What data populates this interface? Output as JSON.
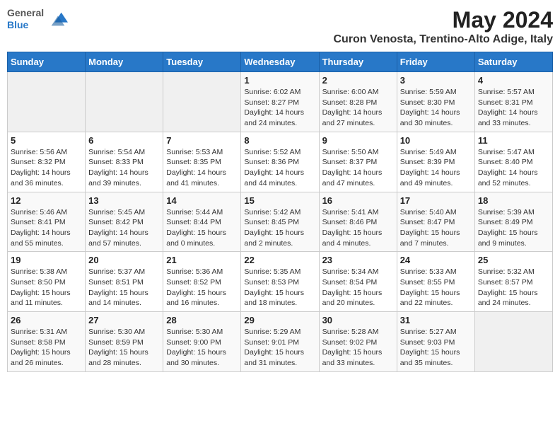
{
  "header": {
    "logo_line1": "General",
    "logo_line2": "Blue",
    "title": "May 2024",
    "subtitle": "Curon Venosta, Trentino-Alto Adige, Italy"
  },
  "weekdays": [
    "Sunday",
    "Monday",
    "Tuesday",
    "Wednesday",
    "Thursday",
    "Friday",
    "Saturday"
  ],
  "weeks": [
    [
      {
        "day": "",
        "info": ""
      },
      {
        "day": "",
        "info": ""
      },
      {
        "day": "",
        "info": ""
      },
      {
        "day": "1",
        "info": "Sunrise: 6:02 AM\nSunset: 8:27 PM\nDaylight: 14 hours and 24 minutes."
      },
      {
        "day": "2",
        "info": "Sunrise: 6:00 AM\nSunset: 8:28 PM\nDaylight: 14 hours and 27 minutes."
      },
      {
        "day": "3",
        "info": "Sunrise: 5:59 AM\nSunset: 8:30 PM\nDaylight: 14 hours and 30 minutes."
      },
      {
        "day": "4",
        "info": "Sunrise: 5:57 AM\nSunset: 8:31 PM\nDaylight: 14 hours and 33 minutes."
      }
    ],
    [
      {
        "day": "5",
        "info": "Sunrise: 5:56 AM\nSunset: 8:32 PM\nDaylight: 14 hours and 36 minutes."
      },
      {
        "day": "6",
        "info": "Sunrise: 5:54 AM\nSunset: 8:33 PM\nDaylight: 14 hours and 39 minutes."
      },
      {
        "day": "7",
        "info": "Sunrise: 5:53 AM\nSunset: 8:35 PM\nDaylight: 14 hours and 41 minutes."
      },
      {
        "day": "8",
        "info": "Sunrise: 5:52 AM\nSunset: 8:36 PM\nDaylight: 14 hours and 44 minutes."
      },
      {
        "day": "9",
        "info": "Sunrise: 5:50 AM\nSunset: 8:37 PM\nDaylight: 14 hours and 47 minutes."
      },
      {
        "day": "10",
        "info": "Sunrise: 5:49 AM\nSunset: 8:39 PM\nDaylight: 14 hours and 49 minutes."
      },
      {
        "day": "11",
        "info": "Sunrise: 5:47 AM\nSunset: 8:40 PM\nDaylight: 14 hours and 52 minutes."
      }
    ],
    [
      {
        "day": "12",
        "info": "Sunrise: 5:46 AM\nSunset: 8:41 PM\nDaylight: 14 hours and 55 minutes."
      },
      {
        "day": "13",
        "info": "Sunrise: 5:45 AM\nSunset: 8:42 PM\nDaylight: 14 hours and 57 minutes."
      },
      {
        "day": "14",
        "info": "Sunrise: 5:44 AM\nSunset: 8:44 PM\nDaylight: 15 hours and 0 minutes."
      },
      {
        "day": "15",
        "info": "Sunrise: 5:42 AM\nSunset: 8:45 PM\nDaylight: 15 hours and 2 minutes."
      },
      {
        "day": "16",
        "info": "Sunrise: 5:41 AM\nSunset: 8:46 PM\nDaylight: 15 hours and 4 minutes."
      },
      {
        "day": "17",
        "info": "Sunrise: 5:40 AM\nSunset: 8:47 PM\nDaylight: 15 hours and 7 minutes."
      },
      {
        "day": "18",
        "info": "Sunrise: 5:39 AM\nSunset: 8:49 PM\nDaylight: 15 hours and 9 minutes."
      }
    ],
    [
      {
        "day": "19",
        "info": "Sunrise: 5:38 AM\nSunset: 8:50 PM\nDaylight: 15 hours and 11 minutes."
      },
      {
        "day": "20",
        "info": "Sunrise: 5:37 AM\nSunset: 8:51 PM\nDaylight: 15 hours and 14 minutes."
      },
      {
        "day": "21",
        "info": "Sunrise: 5:36 AM\nSunset: 8:52 PM\nDaylight: 15 hours and 16 minutes."
      },
      {
        "day": "22",
        "info": "Sunrise: 5:35 AM\nSunset: 8:53 PM\nDaylight: 15 hours and 18 minutes."
      },
      {
        "day": "23",
        "info": "Sunrise: 5:34 AM\nSunset: 8:54 PM\nDaylight: 15 hours and 20 minutes."
      },
      {
        "day": "24",
        "info": "Sunrise: 5:33 AM\nSunset: 8:55 PM\nDaylight: 15 hours and 22 minutes."
      },
      {
        "day": "25",
        "info": "Sunrise: 5:32 AM\nSunset: 8:57 PM\nDaylight: 15 hours and 24 minutes."
      }
    ],
    [
      {
        "day": "26",
        "info": "Sunrise: 5:31 AM\nSunset: 8:58 PM\nDaylight: 15 hours and 26 minutes."
      },
      {
        "day": "27",
        "info": "Sunrise: 5:30 AM\nSunset: 8:59 PM\nDaylight: 15 hours and 28 minutes."
      },
      {
        "day": "28",
        "info": "Sunrise: 5:30 AM\nSunset: 9:00 PM\nDaylight: 15 hours and 30 minutes."
      },
      {
        "day": "29",
        "info": "Sunrise: 5:29 AM\nSunset: 9:01 PM\nDaylight: 15 hours and 31 minutes."
      },
      {
        "day": "30",
        "info": "Sunrise: 5:28 AM\nSunset: 9:02 PM\nDaylight: 15 hours and 33 minutes."
      },
      {
        "day": "31",
        "info": "Sunrise: 5:27 AM\nSunset: 9:03 PM\nDaylight: 15 hours and 35 minutes."
      },
      {
        "day": "",
        "info": ""
      }
    ]
  ]
}
